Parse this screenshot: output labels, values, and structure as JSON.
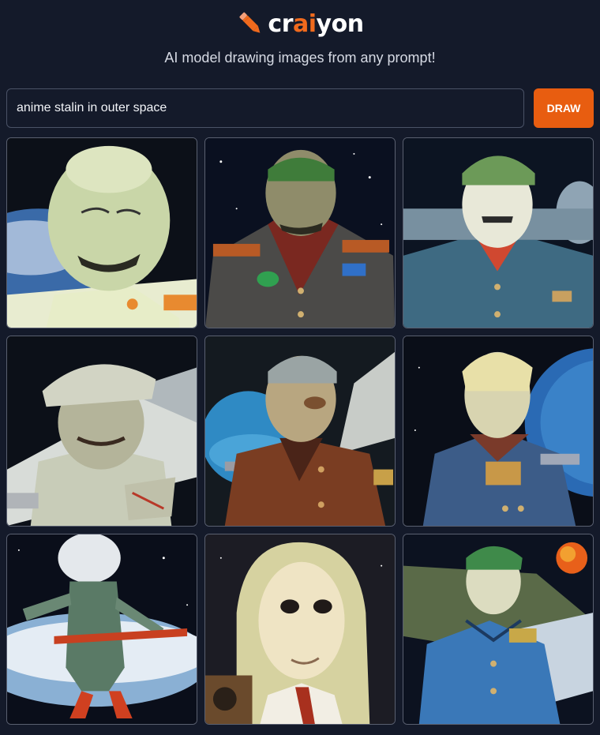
{
  "app": {
    "logo": {
      "prefix": "cr",
      "highlight": "ai",
      "suffix": "yon",
      "icon": "pencil-icon"
    },
    "tagline": "AI model drawing images from any prompt!"
  },
  "prompt": {
    "value": "anime stalin in outer space",
    "placeholder": ""
  },
  "draw_button": {
    "label": "DRAW"
  },
  "colors": {
    "background": "#141a2a",
    "accent": "#f06a1d",
    "button": "#e85d10",
    "input_border": "#4a5266"
  },
  "results": {
    "images": [
      {
        "id": "result-image-1"
      },
      {
        "id": "result-image-2"
      },
      {
        "id": "result-image-3"
      },
      {
        "id": "result-image-4"
      },
      {
        "id": "result-image-5"
      },
      {
        "id": "result-image-6"
      },
      {
        "id": "result-image-7"
      },
      {
        "id": "result-image-8"
      },
      {
        "id": "result-image-9"
      }
    ]
  }
}
